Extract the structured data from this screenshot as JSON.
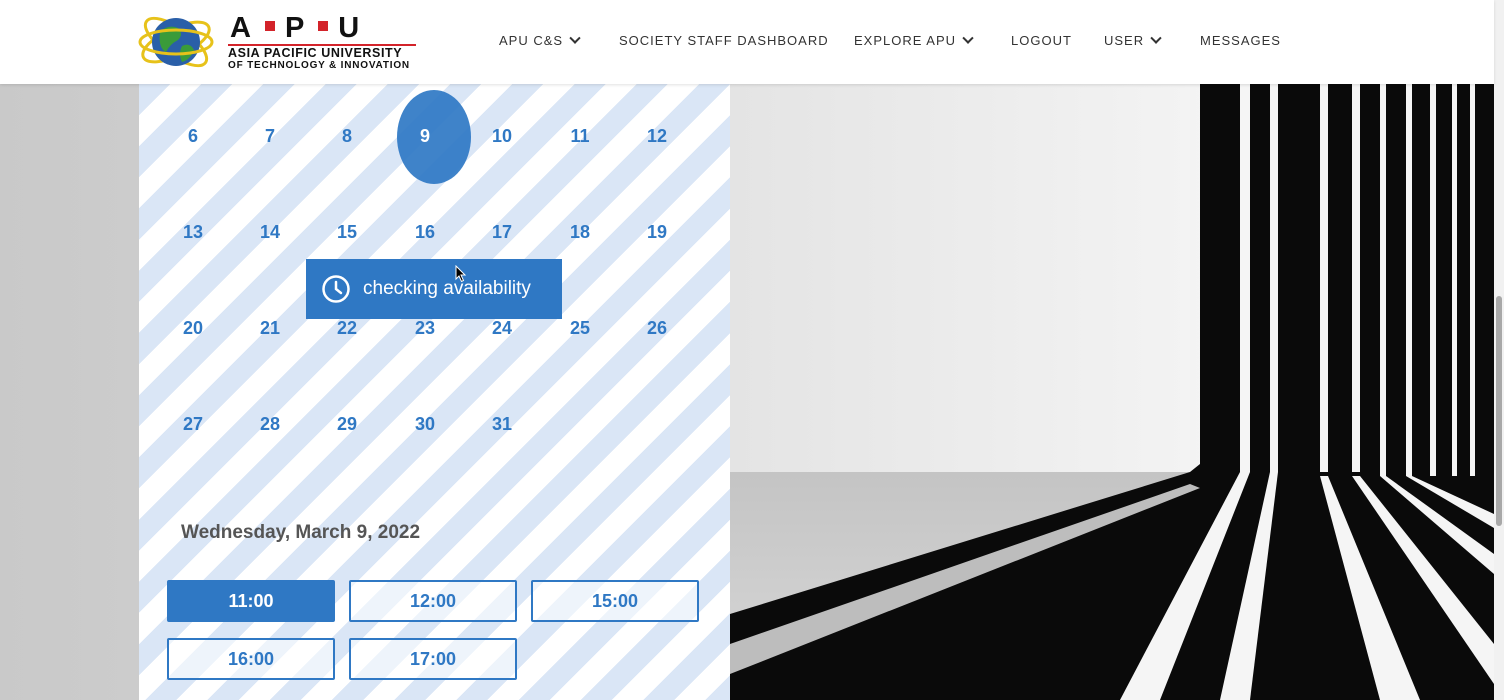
{
  "header": {
    "logo": {
      "letters": [
        "A",
        "P",
        "U"
      ],
      "line1": "ASIA PACIFIC UNIVERSITY",
      "line2": "OF TECHNOLOGY & INNOVATION"
    },
    "nav": [
      {
        "label": "APU C&S",
        "has_dropdown": true
      },
      {
        "label": "SOCIETY STAFF DASHBOARD",
        "has_dropdown": false
      },
      {
        "label": "EXPLORE APU",
        "has_dropdown": true
      },
      {
        "label": "LOGOUT",
        "has_dropdown": false
      },
      {
        "label": "USER",
        "has_dropdown": true
      },
      {
        "label": "MESSAGES",
        "has_dropdown": false
      }
    ]
  },
  "calendar": {
    "weeks": [
      [
        "6",
        "7",
        "8",
        "9",
        "10",
        "11",
        "12"
      ],
      [
        "13",
        "14",
        "15",
        "16",
        "17",
        "18",
        "19"
      ],
      [
        "20",
        "21",
        "22",
        "23",
        "24",
        "25",
        "26"
      ],
      [
        "27",
        "28",
        "29",
        "30",
        "31"
      ]
    ],
    "selected_day": "9",
    "selected_date_label": "Wednesday, March 9, 2022",
    "availability_message": "checking availability",
    "time_slots": [
      {
        "label": "11:00",
        "selected": true
      },
      {
        "label": "12:00",
        "selected": false
      },
      {
        "label": "15:00",
        "selected": false
      },
      {
        "label": "16:00",
        "selected": false
      },
      {
        "label": "17:00",
        "selected": false
      }
    ]
  },
  "colors": {
    "accent": "#2f78c4",
    "stripe": "#dae6f6",
    "brand_red": "#d3232a"
  },
  "icons": {
    "clock": "clock-icon",
    "chevron": "chevron-down-icon"
  }
}
